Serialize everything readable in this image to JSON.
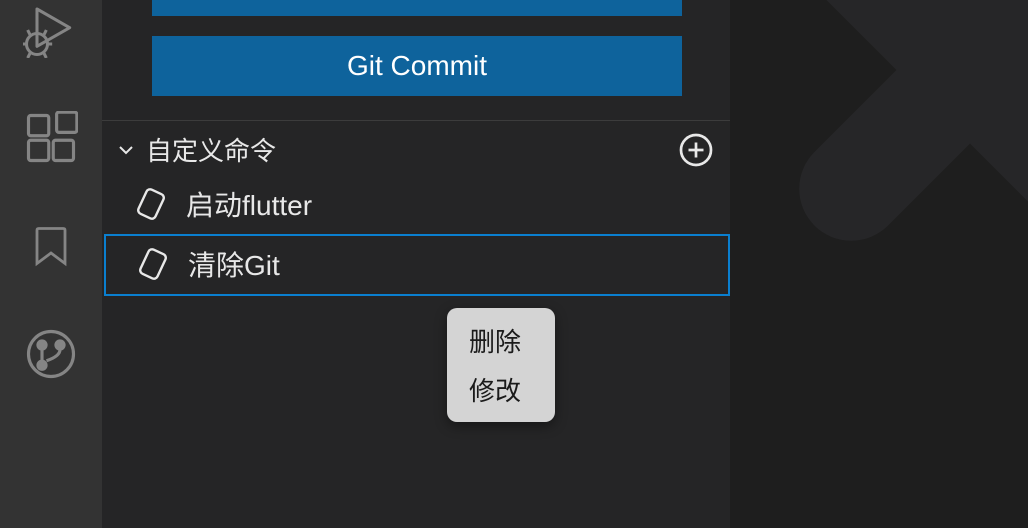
{
  "buttons": {
    "partial_top": "",
    "git_commit": "Git Commit"
  },
  "section": {
    "title": "自定义命令"
  },
  "commands": [
    {
      "label": "启动flutter"
    },
    {
      "label": "清除Git"
    }
  ],
  "context_menu": [
    "删除",
    "修改"
  ]
}
